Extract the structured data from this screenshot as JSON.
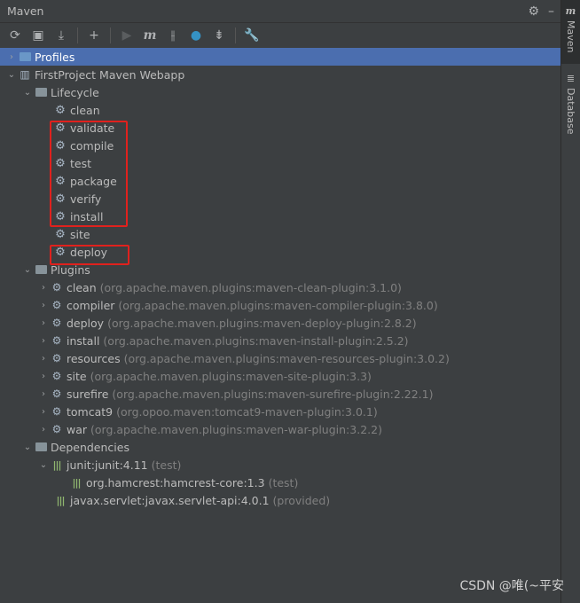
{
  "header": {
    "title": "Maven"
  },
  "sidebar": {
    "maven_label": "Maven",
    "database_label": "Database"
  },
  "tree": {
    "profiles": "Profiles",
    "project": "FirstProject Maven Webapp",
    "lifecycle": {
      "label": "Lifecycle",
      "items": [
        "clean",
        "validate",
        "compile",
        "test",
        "package",
        "verify",
        "install",
        "site",
        "deploy"
      ]
    },
    "plugins": {
      "label": "Plugins",
      "items": [
        {
          "name": "clean",
          "coord": "(org.apache.maven.plugins:maven-clean-plugin:3.1.0)"
        },
        {
          "name": "compiler",
          "coord": "(org.apache.maven.plugins:maven-compiler-plugin:3.8.0)"
        },
        {
          "name": "deploy",
          "coord": "(org.apache.maven.plugins:maven-deploy-plugin:2.8.2)"
        },
        {
          "name": "install",
          "coord": "(org.apache.maven.plugins:maven-install-plugin:2.5.2)"
        },
        {
          "name": "resources",
          "coord": "(org.apache.maven.plugins:maven-resources-plugin:3.0.2)"
        },
        {
          "name": "site",
          "coord": "(org.apache.maven.plugins:maven-site-plugin:3.3)"
        },
        {
          "name": "surefire",
          "coord": "(org.apache.maven.plugins:maven-surefire-plugin:2.22.1)"
        },
        {
          "name": "tomcat9",
          "coord": "(org.opoo.maven:tomcat9-maven-plugin:3.0.1)"
        },
        {
          "name": "war",
          "coord": "(org.apache.maven.plugins:maven-war-plugin:3.2.2)"
        }
      ]
    },
    "dependencies": {
      "label": "Dependencies",
      "junit": {
        "name": "junit:junit:4.11",
        "scope": "(test)"
      },
      "hamcrest": {
        "name": "org.hamcrest:hamcrest-core:1.3",
        "scope": "(test)"
      },
      "servlet": {
        "name": "javax.servlet:javax.servlet-api:4.0.1",
        "scope": "(provided)"
      }
    }
  },
  "watermark": "CSDN @唯(~平安",
  "colors": {
    "selection": "#4b6eaf",
    "highlight_box": "#e0211d",
    "background": "#3c3f41"
  }
}
